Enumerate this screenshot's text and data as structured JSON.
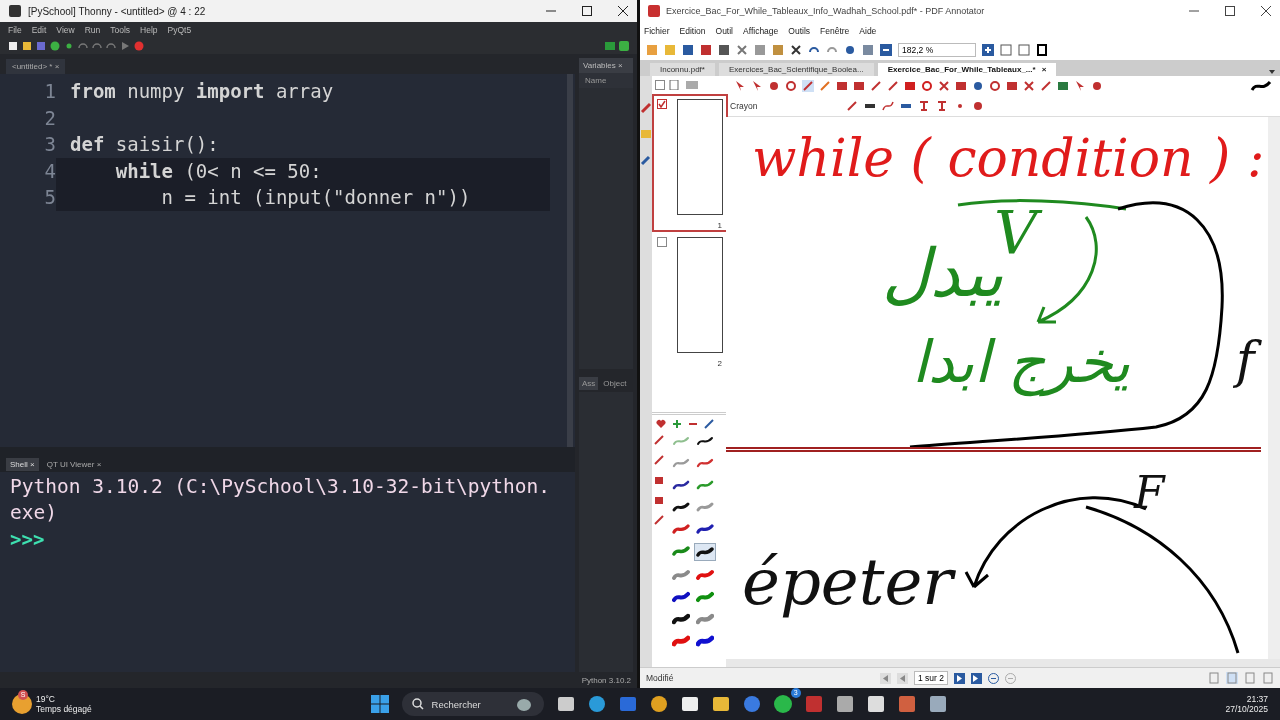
{
  "thonny": {
    "title": "[PySchool] Thonny  -  <untitled>  @  4 : 22",
    "menu": [
      "File",
      "Edit",
      "View",
      "Run",
      "Tools",
      "Help",
      "PyQt5"
    ],
    "editor_tab": {
      "label": "<untitled> *",
      "close": "×"
    },
    "code_lines": [
      {
        "number": "1",
        "text": "**from** numpy **import** array",
        "highlighted": false
      },
      {
        "number": "2",
        "highlighted": false
      },
      {
        "number": "3",
        "text": "**def** saisir():",
        "highlighted": false
      },
      {
        "number": "4",
        "text": "    **while** (0< n <= 50:",
        "highlighted": true
      },
      {
        "number": "5",
        "text": "        n = int (input(\"donner n\"))",
        "highlighted": true
      }
    ],
    "variables_panel": {
      "title": "Variables",
      "close": "×",
      "column": "Name"
    },
    "shell_tabs": [
      {
        "label": "Shell",
        "close": "×",
        "selected": true
      },
      {
        "label": "QT UI Viewer",
        "close": "×",
        "selected": false
      }
    ],
    "shell_output": "Python 3.10.2 (C:\\PySchool\\3.10-32-bit\\python.exe)",
    "shell_prompt": ">>>",
    "side_tabs": [
      {
        "label": "Ass",
        "selected": true
      },
      {
        "label": "Object",
        "selected": false
      }
    ],
    "status": "Python 3.10.2"
  },
  "pdf": {
    "title": "Exercice_Bac_For_While_Tableaux_Info_Wadhah_School.pdf* - PDF Annotator",
    "menu": [
      "Fichier",
      "Edition",
      "Outil",
      "Affichage",
      "Outils",
      "Fenêtre",
      "Aide"
    ],
    "zoom": "182,2 %",
    "doc_tabs": [
      {
        "label": "Inconnu.pdf*",
        "selected": false
      },
      {
        "label": "Exercices_Bac_Scientifique_Boolea...",
        "selected": false
      },
      {
        "label": "Exercice_Bac_For_While_Tableaux_...*",
        "selected": true
      }
    ],
    "doc_tab_close": "×",
    "tool_name": "Crayon",
    "thumbnails": [
      {
        "number": "1",
        "checked": true,
        "selected": true
      },
      {
        "number": "2",
        "checked": false,
        "selected": false
      }
    ],
    "pens": [
      {
        "color": "#8fbf8f",
        "selected": false
      },
      {
        "color": "#111111",
        "selected": false
      },
      {
        "color": "#9a9a9a",
        "selected": false
      },
      {
        "color": "#d03030",
        "selected": false
      },
      {
        "color": "#2a2aa0",
        "selected": false
      },
      {
        "color": "#2a9a2a",
        "selected": false
      },
      {
        "color": "#111111",
        "selected": false
      },
      {
        "color": "#9a9a9a",
        "selected": false
      },
      {
        "color": "#d02020",
        "selected": false
      },
      {
        "color": "#2020b0",
        "selected": false
      },
      {
        "color": "#1a8a1a",
        "selected": false
      },
      {
        "color": "#111111",
        "selected": true
      },
      {
        "color": "#8a8a8a",
        "selected": false
      },
      {
        "color": "#e01010",
        "selected": false
      },
      {
        "color": "#1010c0",
        "selected": false
      },
      {
        "color": "#109010",
        "selected": false
      },
      {
        "color": "#111111",
        "selected": false
      },
      {
        "color": "#8a8a8a",
        "selected": false
      },
      {
        "color": "#e01010",
        "selected": false
      },
      {
        "color": "#1010d0",
        "selected": false
      }
    ],
    "ink": [
      {
        "text": "while ( condition ) :",
        "color": "#e01b1b"
      },
      {
        "text": "V",
        "color": "#1f8a1f"
      },
      {
        "text": "يبدل",
        "color": "#1f8a1f"
      },
      {
        "text": "يخرج ابدا",
        "color": "#1f8a1f"
      },
      {
        "text": "f",
        "color": "#111111"
      },
      {
        "text": "F",
        "color": "#111111"
      },
      {
        "text": "épeter",
        "color": "#111111"
      }
    ],
    "status": "Modifié",
    "page_field": "1 sur 2"
  },
  "taskbar": {
    "temperature": "19°C",
    "weather": "Temps dégagé",
    "weather_badge": "S",
    "search_placeholder": "Rechercher",
    "chat_badge": "3",
    "time": "21:37",
    "date": "27/10/2025"
  }
}
